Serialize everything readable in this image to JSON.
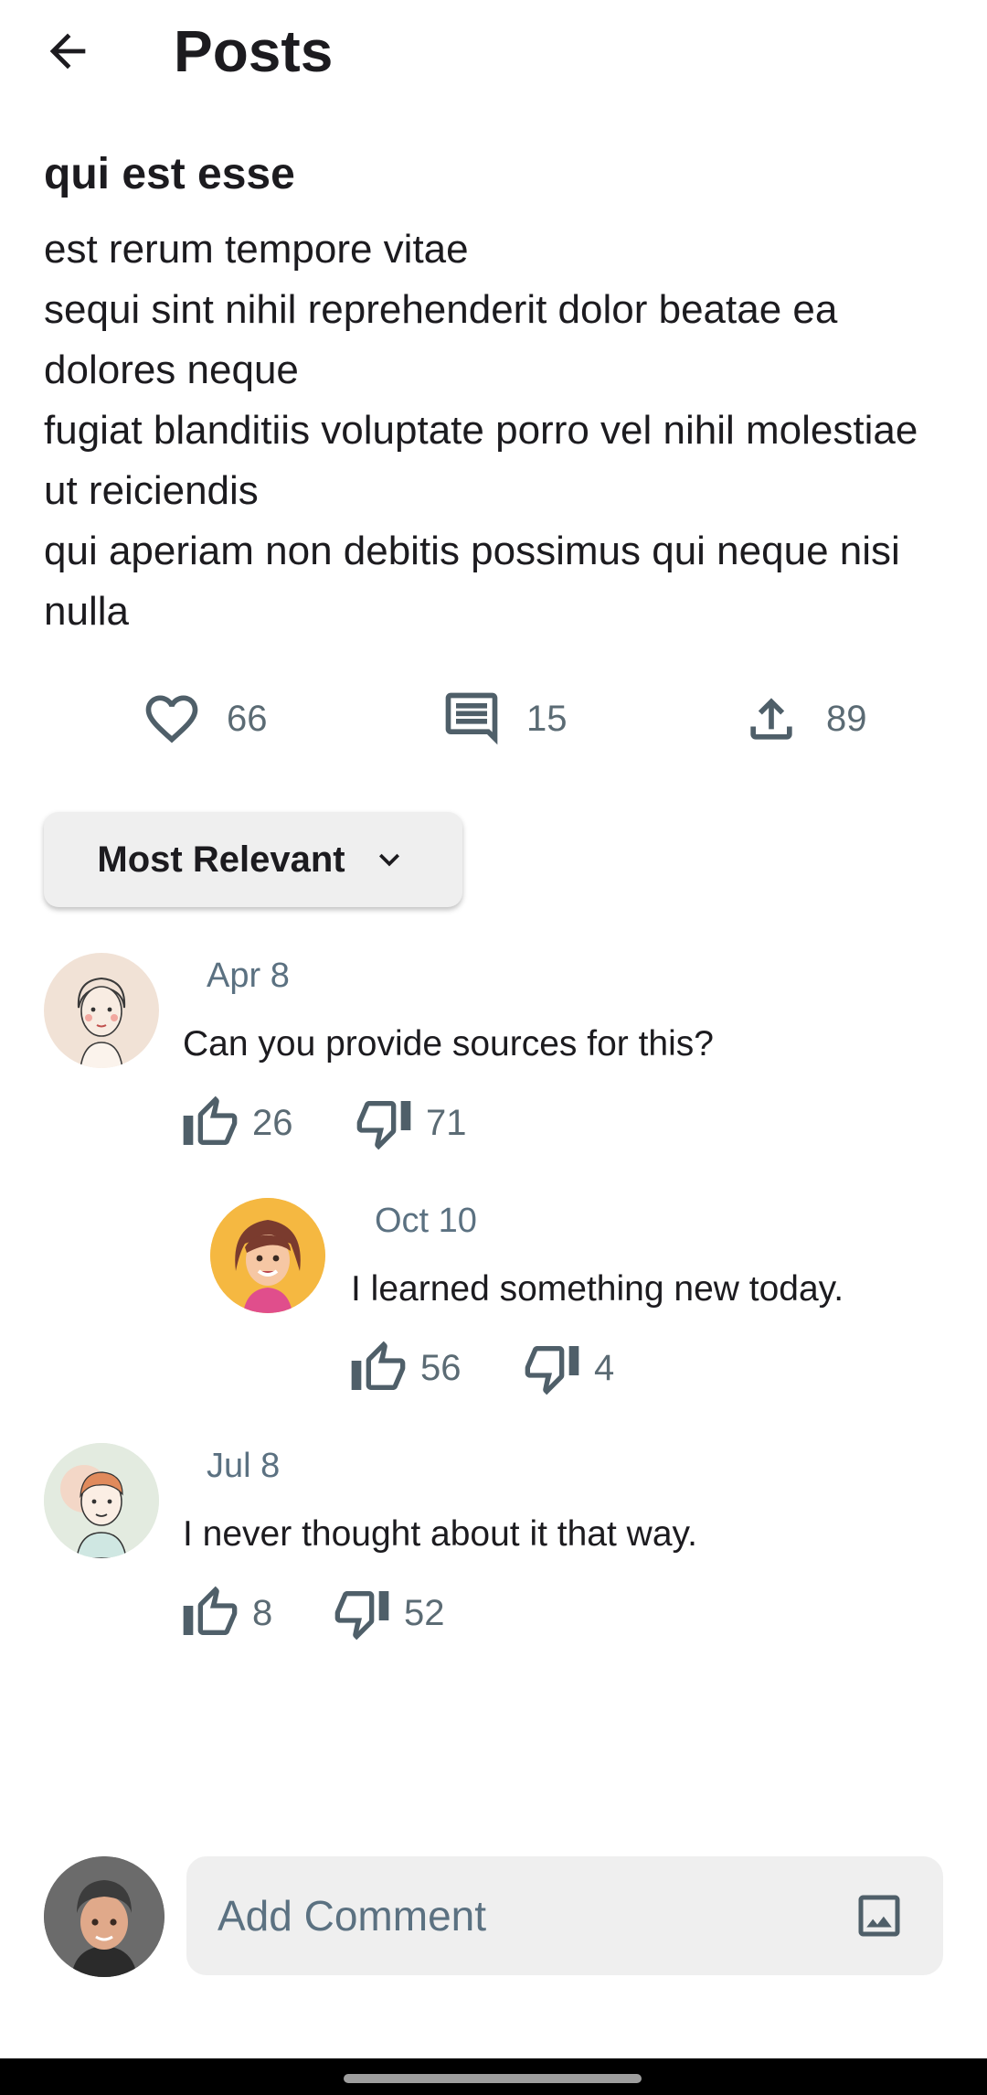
{
  "app_bar": {
    "title": "Posts",
    "back_icon": "arrow-back-icon"
  },
  "post": {
    "title": "qui est esse",
    "body": "est rerum tempore vitae\nsequi sint nihil reprehenderit dolor beatae ea dolores neque\nfugiat blanditiis voluptate porro vel nihil molestiae ut reiciendis\nqui aperiam non debitis possimus qui neque nisi nulla",
    "likes": "66",
    "comments": "15",
    "shares": "89"
  },
  "sort": {
    "label": "Most Relevant",
    "icon": "chevron-down-icon"
  },
  "comments": [
    {
      "date": "Apr 8",
      "text": "Can you provide sources for this?",
      "upvotes": "26",
      "downvotes": "71",
      "avatar": "sketch-girl-avatar"
    },
    {
      "date": "Oct 10",
      "text": "I learned something new today.",
      "upvotes": "56",
      "downvotes": "4",
      "avatar": "cartoon-woman-avatar"
    },
    {
      "date": "Jul 8",
      "text": "I never thought about it that way.",
      "upvotes": "8",
      "downvotes": "52",
      "avatar": "sketch-boy-avatar"
    }
  ],
  "composer": {
    "placeholder": "Add Comment",
    "image_icon": "image-icon",
    "avatar": "current-user-avatar"
  },
  "colors": {
    "icon": "#4f5f69",
    "count_text": "#5b6b74",
    "date_text": "#5b7181",
    "input_bg": "#efefef"
  }
}
